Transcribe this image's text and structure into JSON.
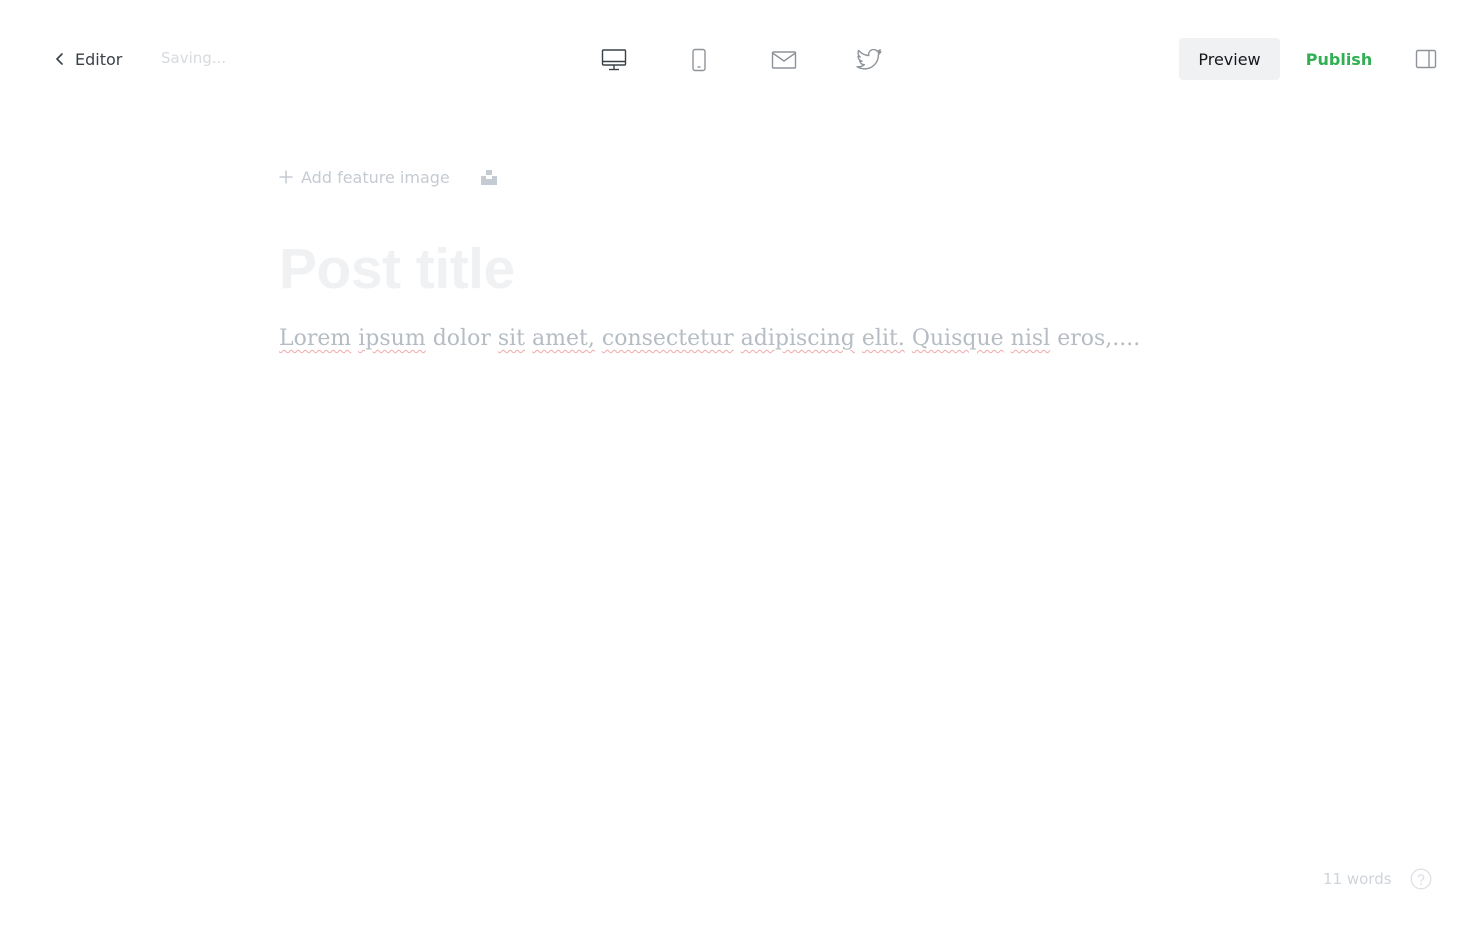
{
  "header": {
    "back_label": "Editor",
    "status_text": "Saving...",
    "preview_label": "Preview",
    "publish_label": "Publish",
    "preview_modes": [
      {
        "icon": "desktop-icon"
      },
      {
        "icon": "mobile-icon"
      },
      {
        "icon": "email-icon"
      },
      {
        "icon": "twitter-icon"
      }
    ],
    "sidebar_toggle_icon": "sidebar-toggle-icon"
  },
  "editor": {
    "feature_image_label": "Add feature image",
    "title_placeholder": "Post title",
    "body_words": [
      "Lorem",
      "ipsum",
      "dolor",
      "sit",
      "amet,",
      "consectetur",
      "adipiscing",
      "elit.",
      "Quisque",
      "nisl",
      "eros,...."
    ]
  },
  "footer": {
    "word_count": "11 words",
    "help_icon": "help-icon"
  },
  "colors": {
    "publish": "#30b052",
    "preview_bg": "#eff1f3",
    "spellcheck_underline": "#f3a8a8"
  }
}
